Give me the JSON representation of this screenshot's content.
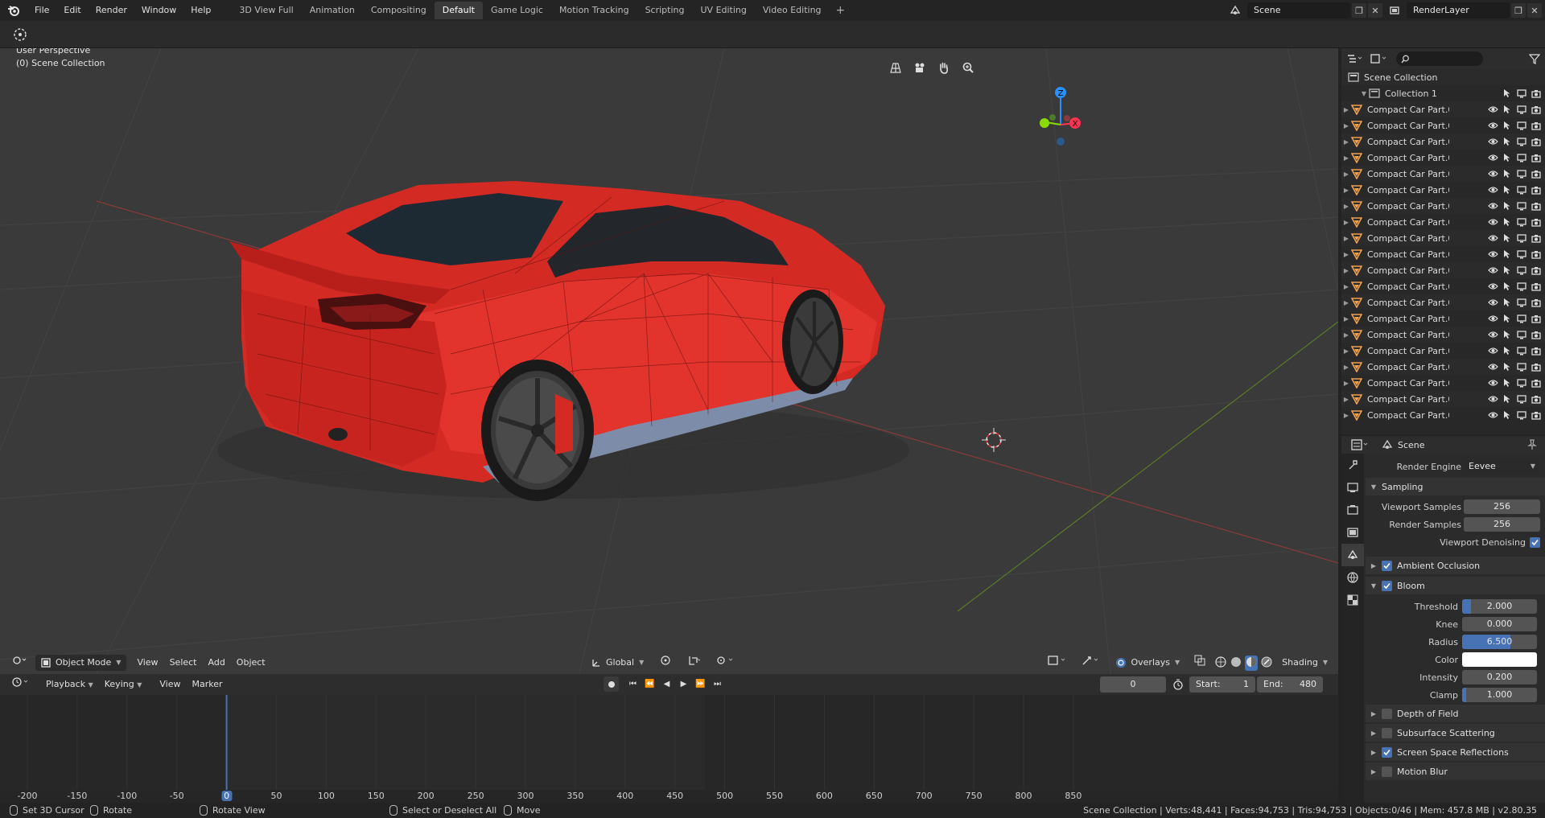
{
  "topbar": {
    "menu": [
      "File",
      "Edit",
      "Render",
      "Window",
      "Help"
    ],
    "workspaces": [
      "3D View Full",
      "Animation",
      "Compositing",
      "Default",
      "Game Logic",
      "Motion Tracking",
      "Scripting",
      "UV Editing",
      "Video Editing"
    ],
    "active_workspace": "Default",
    "add_workspace": "+",
    "scene": "Scene",
    "view_layer": "RenderLayer"
  },
  "viewport": {
    "perspective": "User Perspective",
    "collection": "(0) Scene Collection",
    "header": {
      "mode": "Object Mode",
      "menus": [
        "View",
        "Select",
        "Add",
        "Object"
      ],
      "orientation": "Global",
      "overlays": "Overlays",
      "shading": "Shading"
    },
    "gizmo": {
      "z": "Z",
      "x": "X",
      "y": "Y"
    }
  },
  "outliner": {
    "root": "Scene Collection",
    "collection": "Collection 1",
    "objects": [
      "Compact Car Part.0(",
      "Compact Car Part.0(",
      "Compact Car Part.0(",
      "Compact Car Part.0(",
      "Compact Car Part.0",
      "Compact Car Part.0",
      "Compact Car Part.0",
      "Compact Car Part.0",
      "Compact Car Part.0",
      "Compact Car Part.0",
      "Compact Car Part.0",
      "Compact Car Part.0",
      "Compact Car Part.0",
      "Compact Car Part.0",
      "Compact Car Part.0",
      "Compact Car Part.0",
      "Compact Car Part.0",
      "Compact Car Part.0",
      "Compact Car Part.0",
      "Compact Car Part.0"
    ]
  },
  "properties": {
    "context": "Scene",
    "render_engine_label": "Render Engine",
    "render_engine": "Eevee",
    "sampling": {
      "title": "Sampling",
      "viewport_samples_label": "Viewport Samples",
      "viewport_samples": "256",
      "render_samples_label": "Render Samples",
      "render_samples": "256",
      "viewport_denoising": "Viewport Denoising"
    },
    "ambient_occlusion": "Ambient Occlusion",
    "bloom": {
      "title": "Bloom",
      "threshold_label": "Threshold",
      "threshold": "2.000",
      "threshold_fill": 0.12,
      "knee_label": "Knee",
      "knee": "0.000",
      "knee_fill": 0.0,
      "radius_label": "Radius",
      "radius": "6.500",
      "radius_fill": 0.65,
      "color_label": "Color",
      "color": "#ffffff",
      "intensity_label": "Intensity",
      "intensity": "0.200",
      "intensity_fill": 0.0,
      "clamp_label": "Clamp",
      "clamp": "1.000",
      "clamp_fill": 0.05
    },
    "panels": [
      "Depth of Field",
      "Subsurface Scattering",
      "Screen Space Reflections",
      "Motion Blur"
    ],
    "panels_checked": [
      false,
      false,
      true,
      false
    ]
  },
  "timeline": {
    "menus": [
      "Playback",
      "Keying",
      "View",
      "Marker"
    ],
    "current_frame": "0",
    "start_label": "Start:",
    "start": "1",
    "end_label": "End:",
    "end": "480",
    "ticks": [
      "-200",
      "-150",
      "-100",
      "-50",
      "0",
      "50",
      "100",
      "150",
      "200",
      "250",
      "300",
      "350",
      "400",
      "450",
      "500",
      "550",
      "600",
      "650",
      "700",
      "750",
      "800",
      "850"
    ]
  },
  "statusbar": {
    "set_cursor": "Set 3D Cursor",
    "rotate": "Rotate",
    "rotate_view": "Rotate View",
    "select_all": "Select or Deselect All",
    "move": "Move",
    "stats": "Scene Collection | Verts:48,441 | Faces:94,753 | Tris:94,753 | Objects:0/46 | Mem: 457.8 MB | v2.80.35"
  },
  "colors": {
    "accent": "#4772b3",
    "car_body": "#d42a24",
    "object_icon": "#f0a050",
    "axis_x": "#ff3352",
    "axis_y": "#8bdc00",
    "axis_z": "#2890ff"
  }
}
